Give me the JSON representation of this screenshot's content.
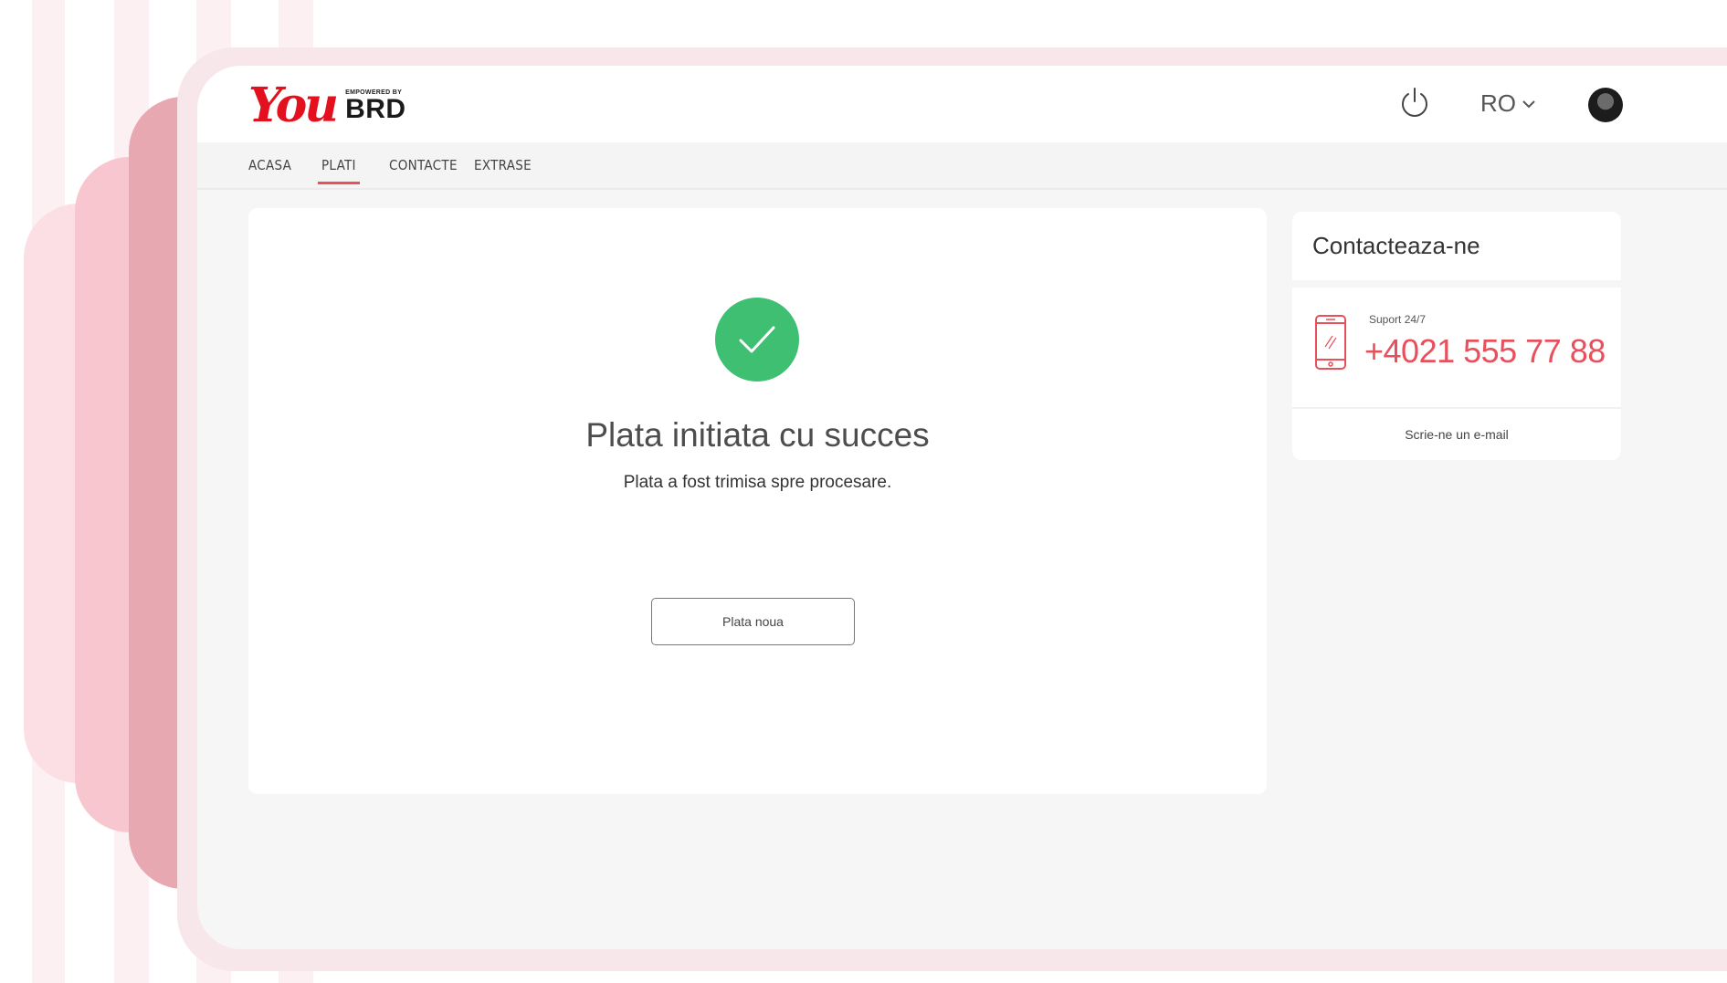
{
  "brand": {
    "logo_word": "You",
    "powered_by": "EMPOWERED BY",
    "bank": "BRD",
    "accent_color": "#e8505b",
    "logo_color": "#e3101e"
  },
  "header": {
    "power_icon": "power-icon",
    "language": "RO",
    "language_icon": "chevron-down-icon",
    "avatar": "user-avatar"
  },
  "nav": {
    "items": [
      {
        "label": "ACASA"
      },
      {
        "label": "PLATI"
      },
      {
        "label": "CONTACTE"
      },
      {
        "label": "EXTRASE"
      }
    ],
    "active": "PLATI"
  },
  "result": {
    "status_icon": "check-icon",
    "status_color": "#3ebf72",
    "title": "Plata initiata cu succes",
    "message": "Plata a fost trimisa spre procesare.",
    "button_label": "Plata noua"
  },
  "contact": {
    "title": "Contacteaza-ne",
    "support_label": "Suport 24/7",
    "phone": "+4021 555 77 88",
    "email_link": "Scrie-ne un e-mail"
  }
}
